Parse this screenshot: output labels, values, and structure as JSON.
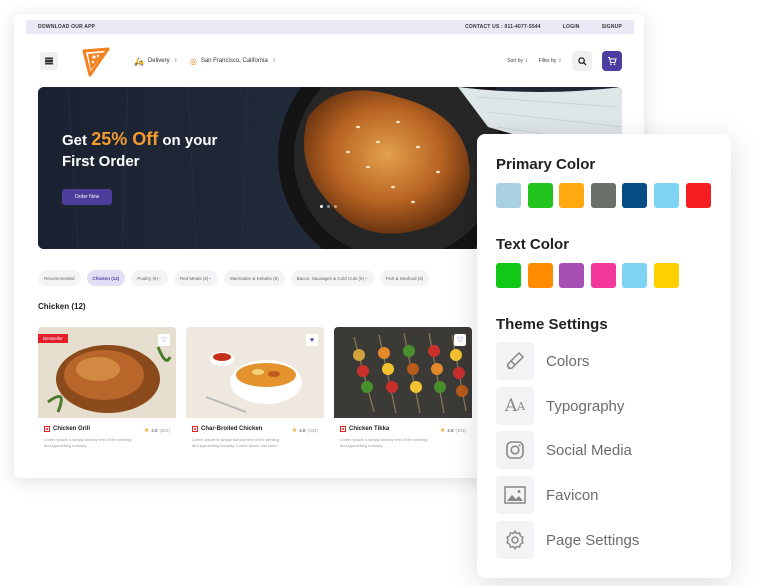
{
  "app": {
    "top_left": "DOWNLOAD OUR APP",
    "contact": "CONTACT US : 011-4077-5544",
    "login": "LOGIN",
    "signup": "SIGNUP"
  },
  "nav": {
    "delivery": "Delivery",
    "location": "San Francisco, California",
    "sort": "Sort by",
    "filter": "Filter by"
  },
  "hero": {
    "line1_pre": "Get",
    "line1_accent": "25% Off",
    "line1_post": "on your",
    "line2": "First Order",
    "button": "Order Now"
  },
  "categories": [
    {
      "label": "Recommended",
      "active": false
    },
    {
      "label": "Chicken (12)",
      "active": true
    },
    {
      "label": "Poultry (8)",
      "active": false,
      "chev": true
    },
    {
      "label": "Red Meats (6)",
      "active": false,
      "chev": true
    },
    {
      "label": "Marinades & Kebabs (6)",
      "active": false
    },
    {
      "label": "Bacon, Sausages & Cold Cuts (6)",
      "active": false,
      "chev": true
    },
    {
      "label": "Fish & Seafood (6)",
      "active": false
    }
  ],
  "section_title": "Chicken (12)",
  "items": [
    {
      "name": "Chicken Grill",
      "rating": "4.5",
      "count": "(201)",
      "badge": "Bestseller",
      "desc1": "Lorem Ipsum is simply dummy text of the printing",
      "desc2": "and typesetting industry."
    },
    {
      "name": "Char-Broiled Chicken",
      "rating": "4.8",
      "count": "(103)",
      "badge": "",
      "desc1": "Lorem Ipsum is simply dummy text of the printing",
      "desc2": "and typesetting industry. Lorem Ipsum has been..."
    },
    {
      "name": "Chicken Tikka",
      "rating": "4.8",
      "count": "(103)",
      "badge": "",
      "desc1": "Lorem Ipsum is simply dummy text of the printing",
      "desc2": "and typesetting industry."
    }
  ],
  "panel": {
    "primary_title": "Primary Color",
    "primary_colors": [
      "#a8d0e2",
      "#24c41f",
      "#ffa80f",
      "#6a716b",
      "#074d84",
      "#7dd4f5",
      "#f31d22"
    ],
    "text_title": "Text Color",
    "text_colors": [
      "#12c817",
      "#ff8c00",
      "#a84fb6",
      "#f4379a",
      "#7ed3f2",
      "#ffd000"
    ],
    "theme_title": "Theme Settings",
    "settings": [
      {
        "label": "Colors",
        "icon": "colors-icon"
      },
      {
        "label": "Typography",
        "icon": "typography-icon"
      },
      {
        "label": "Social Media",
        "icon": "instagram-icon"
      },
      {
        "label": "Favicon",
        "icon": "image-icon"
      },
      {
        "label": "Page Settings",
        "icon": "gear-icon"
      }
    ]
  }
}
